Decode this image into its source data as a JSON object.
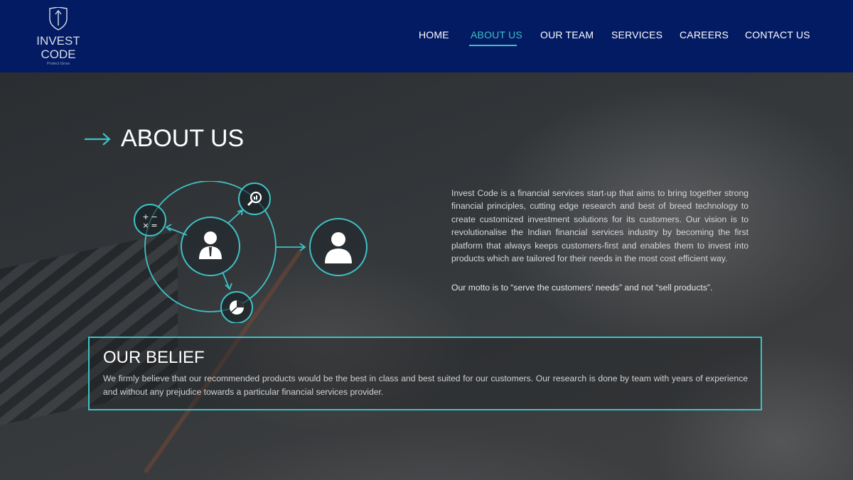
{
  "brand": {
    "logo_line1": "INVEST",
    "logo_line2": "CODE",
    "tagline": "Protect Grow"
  },
  "nav": {
    "items": [
      {
        "label": "HOME"
      },
      {
        "label": "ABOUT US",
        "active": true
      },
      {
        "label": "OUR TEAM"
      },
      {
        "label": "SERVICES"
      },
      {
        "label": "CAREERS"
      },
      {
        "label": "CONTACT US"
      }
    ]
  },
  "about": {
    "title": "ABOUT US",
    "paragraph": "Invest Code is a financial services start-up that aims to bring together strong financial principles, cutting edge research and best of breed technology to create customized investment solutions for its customers. Our vision is to revolutionalise the Indian financial services industry by becoming the first platform that always keeps customers-first and enables them to invest into products which are tailored for their needs in the most cost efficient way.",
    "motto": "Our motto is to “serve the customers’ needs” and not “sell products”."
  },
  "belief": {
    "title": "OUR BELIEF",
    "text": "We firmly believe that our recommended products would be the best in class and best suited for our customers. Our research is done by team with years of experience and without any prejudice towards a particular financial services provider."
  },
  "diagram": {
    "icons": [
      "calculator-icon",
      "magnifier-chart-icon",
      "businessman-icon",
      "pie-chart-icon",
      "customer-icon"
    ]
  },
  "colors": {
    "header_bg": "#031b63",
    "accent": "#3fc1c4",
    "text_light": "#d6d7d8"
  }
}
